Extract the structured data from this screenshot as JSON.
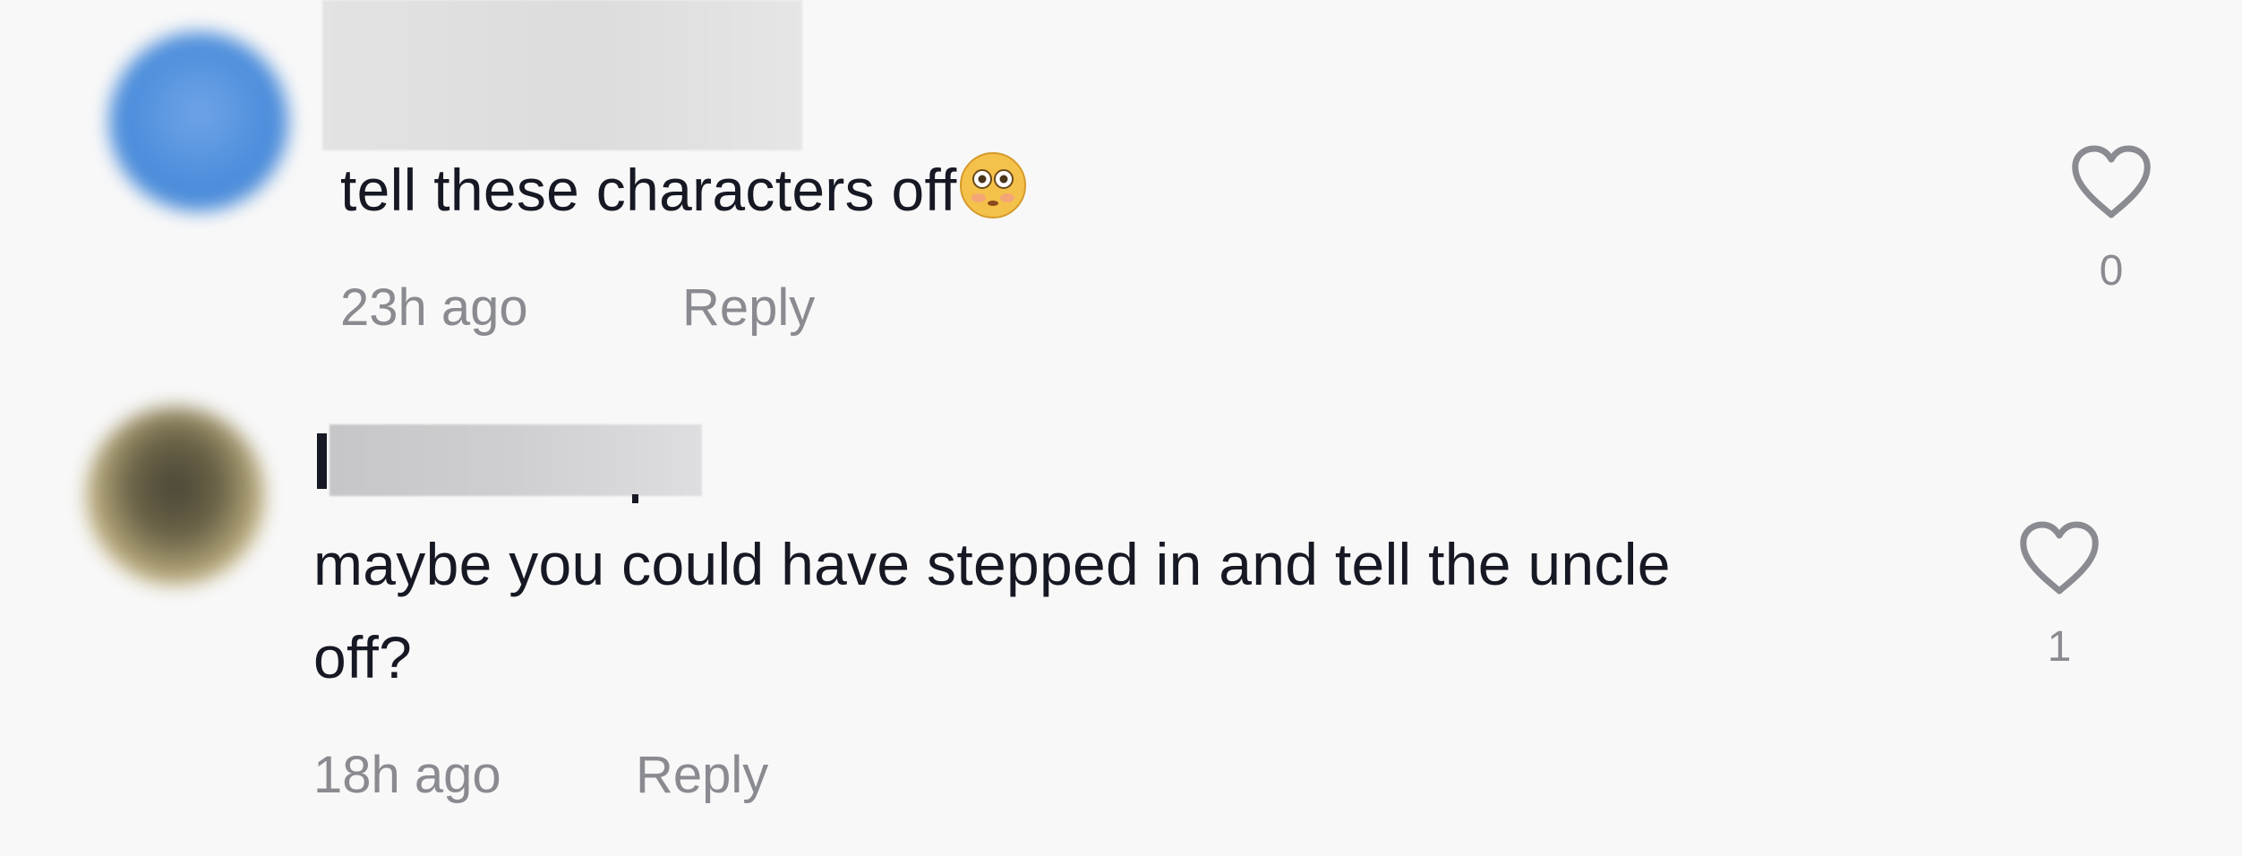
{
  "comments": [
    {
      "text": "tell these characters off",
      "emoji": "flushed-face-emoji",
      "timestamp": "23h ago",
      "reply_label": "Reply",
      "like_count": "0"
    },
    {
      "username_visible": "I",
      "text_line1": "maybe you could have stepped in and tell the uncle",
      "text_line2": "off?",
      "timestamp": "18h ago",
      "reply_label": "Reply",
      "like_count": "1"
    }
  ],
  "colors": {
    "background": "#f8f8f8",
    "text": "#161823",
    "meta": "#8a8b91",
    "heart_outline": "#8a8b91"
  }
}
